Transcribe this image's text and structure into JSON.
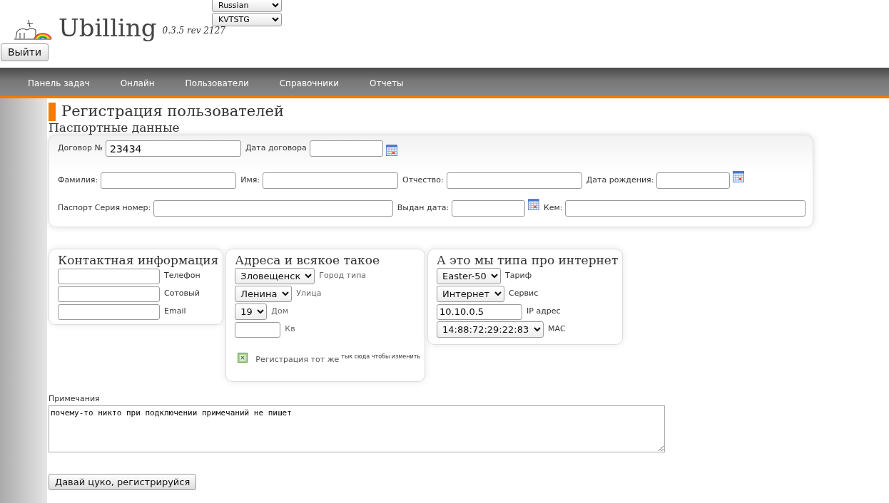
{
  "header": {
    "logo_text": "Ubilling",
    "version": "0.3.5 rev 2127",
    "language_select": "Russian",
    "skin_select": "KVTSTG",
    "logout_button": "Выйти"
  },
  "nav": [
    {
      "label": "Панель задач"
    },
    {
      "label": "Онлайн"
    },
    {
      "label": "Пользователи"
    },
    {
      "label": "Справочники"
    },
    {
      "label": "Отчеты"
    }
  ],
  "page_title": "Регистрация пользователей",
  "passport": {
    "title": "Паспортные данные",
    "lines": [
      {
        "fields": [
          {
            "kind": "text",
            "label": "Договор №",
            "value": "23434"
          },
          {
            "kind": "date",
            "label": "Дата договора"
          }
        ]
      },
      {
        "fields": [
          {
            "kind": "text",
            "label": "Фамилия:"
          },
          {
            "kind": "text",
            "label": "Имя:"
          },
          {
            "kind": "text",
            "label": "Отчество:"
          },
          {
            "kind": "date",
            "label": "Дата рождения:"
          }
        ]
      },
      {
        "fields": [
          {
            "kind": "text",
            "label": "Паспорт Серия номер:"
          },
          {
            "kind": "date",
            "label": "Выдан дата:"
          },
          {
            "kind": "text",
            "label": "Кем:"
          }
        ]
      }
    ]
  },
  "panels": [
    {
      "title": "Контактная информация",
      "fields": [
        {
          "kind": "input",
          "label": "Телефон"
        },
        {
          "kind": "input",
          "label": "Сотовый"
        },
        {
          "kind": "input",
          "label": "Email"
        }
      ]
    },
    {
      "title": "Адреса и всякое такое",
      "fields": [
        {
          "kind": "select",
          "value": "Зловещенск",
          "label": "Город типа"
        },
        {
          "kind": "select",
          "value": "Ленина",
          "label": "Улица"
        },
        {
          "kind": "select",
          "value": "19",
          "label": "Дом"
        },
        {
          "kind": "input",
          "label": "Кв"
        }
      ],
      "same_registration": {
        "checked": true,
        "label": "Регистрация тот же",
        "hint": "тык сюда чтобы изменить"
      }
    },
    {
      "title": "А это мы типа про интернет",
      "fields": [
        {
          "kind": "select",
          "value": "Easter-50",
          "label": "Тариф"
        },
        {
          "kind": "select",
          "value": "Интернет",
          "label": "Сервис"
        },
        {
          "kind": "input",
          "value": "10.10.0.5",
          "label": "IP адрес"
        },
        {
          "kind": "select",
          "value": "14:88:72:29:22:83",
          "label": "MAC"
        }
      ]
    }
  ],
  "notes": {
    "label": "Примечания",
    "value": "почему-то никто при подключении примечаний не пишет"
  },
  "submit_button": "Давай цуко, регистрируйся"
}
